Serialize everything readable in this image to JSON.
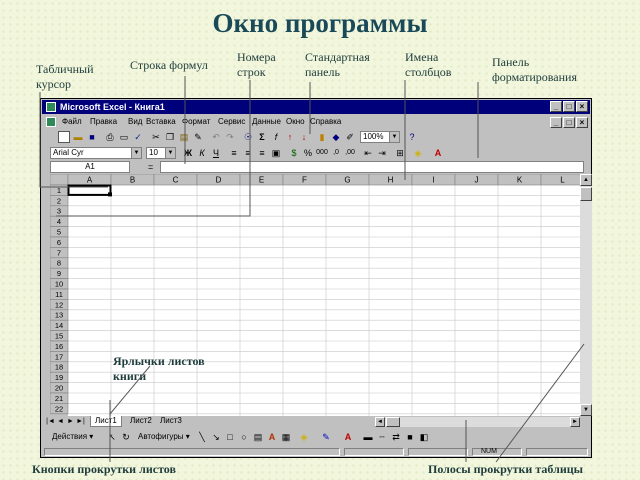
{
  "slide": {
    "title": "Окно программы",
    "callouts": {
      "cursor": [
        "Табличный",
        "курсор"
      ],
      "formula_bar": [
        "Строка формул"
      ],
      "row_numbers": [
        "Номера",
        "строк"
      ],
      "standard_toolbar": [
        "Стандартная",
        "панель"
      ],
      "column_names": [
        "Имена",
        "столбцов"
      ],
      "format_toolbar": [
        "Панель",
        "форматирования"
      ],
      "sheet_tabs": [
        "Ярлычки листов",
        "книги"
      ],
      "scroll_buttons": "Кнопки прокрутки листов",
      "scrollbars": "Полосы прокрутки таблицы"
    }
  },
  "excel": {
    "window_title": "Microsoft Excel - Книга1",
    "menu": [
      "Файл",
      "Правка",
      "Вид",
      "Вставка",
      "Формат",
      "Сервис",
      "Данные",
      "Окно",
      "Справка"
    ],
    "zoom": "100%",
    "font_name": "Arial Cyr",
    "font_size": "10",
    "name_box": "A1",
    "formula_eq": "=",
    "columns": [
      "A",
      "B",
      "C",
      "D",
      "E",
      "F",
      "G",
      "H",
      "I",
      "J",
      "K",
      "L"
    ],
    "rows": [
      "1",
      "2",
      "3",
      "4",
      "5",
      "6",
      "7",
      "8",
      "9",
      "10",
      "11",
      "12",
      "13",
      "14",
      "15",
      "16",
      "17",
      "18",
      "19",
      "20",
      "21",
      "22"
    ],
    "sheet_tabs": [
      "Лист1",
      "Лист2",
      "Лист3"
    ],
    "draw_menu": "Действия",
    "autoshapes": "Автофигуры",
    "status": "NUM"
  }
}
